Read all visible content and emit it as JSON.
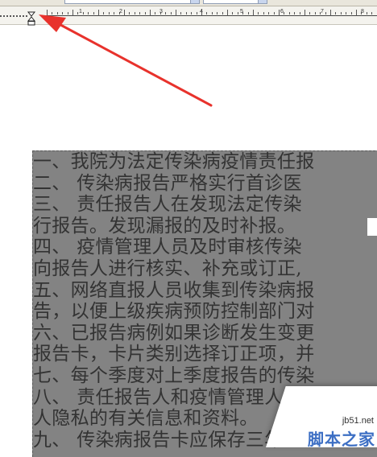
{
  "ruler": {
    "labels": [
      "1",
      "2",
      "3",
      "4",
      "5",
      "6",
      "7",
      "8"
    ]
  },
  "document": {
    "lines": [
      "一、我院为法定传染病疫情责任报",
      "二、  传染病报告严格实行首诊医",
      "三、  责任报告人在发现法定传染",
      "行报告。发现漏报的及时补报。",
      "四、  疫情管理人员及时审核传染",
      "向报告人进行核实、补充或订正,",
      "五、网络直报人员收集到传染病报",
      "告，以便上级疾病预防控制部门对",
      "六、已报告病例如果诊断发生变更",
      "报告卡，卡片类别选择订正项，并",
      "七、每个季度对上季度报告的传染",
      "八、  责任报告人和疫情管理人员",
      "人隐私的有关信息和资料。",
      "九、  传染病报告卡应保存三年"
    ]
  },
  "watermark": {
    "url": "jb51.net",
    "name": "脚本之家"
  },
  "colors": {
    "selection_bg": "#838383",
    "arrow": "#e8322c",
    "watermark_text": "#3d6fc4"
  }
}
